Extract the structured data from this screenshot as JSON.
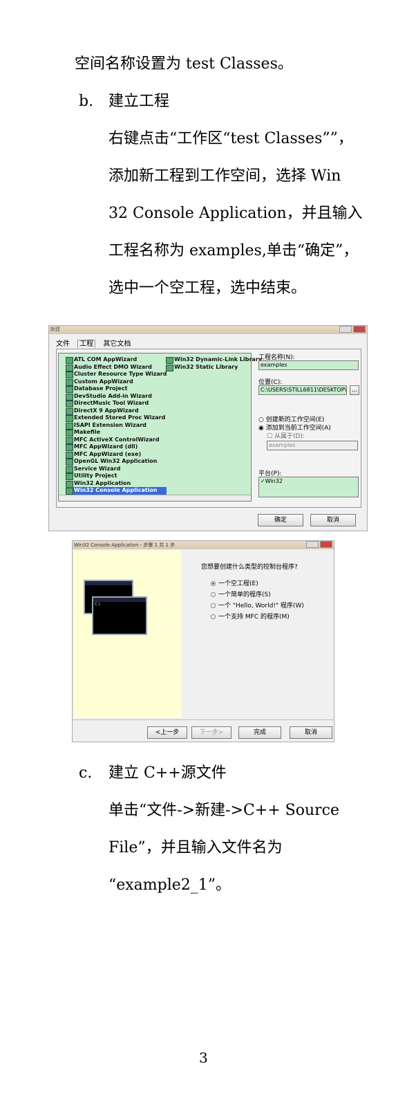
{
  "doc": {
    "line1": "空间名称设置为 test Classes。",
    "b_marker": "b.",
    "b_title": "建立工程",
    "b_p1": "右键点击“工作区“test Classes””，",
    "b_p2": "添加新工程到工作空间，选择 Win",
    "b_p3": "32 Console Application，并且输入",
    "b_p4": "工程名称为 examples,单击“确定”，",
    "b_p5": "选中一个空工程，选中结束。",
    "c_marker": "c.",
    "c_title": "建立 C++源文件",
    "c_p1": "单击“文件->新建->C++ Source",
    "c_p2": "File”，并且输入文件名为",
    "c_p3": "“example2_1”。",
    "page_number": "3"
  },
  "dialog_new": {
    "title": "新建",
    "tabs": [
      "文件",
      "工程",
      "其它文档"
    ],
    "project_types_col1": [
      "ATL COM AppWizard",
      "Audio Effect DMO Wizard",
      "Cluster Resource Type Wizard",
      "Custom AppWizard",
      "Database Project",
      "DevStudio Add-in Wizard",
      "DirectMusic Tool Wizard",
      "DirectX 9 AppWizard",
      "Extended Stored Proc Wizard",
      "ISAPI Extension Wizard",
      "Makefile",
      "MFC ActiveX ControlWizard",
      "MFC AppWizard (dll)",
      "MFC AppWizard (exe)",
      "OpenGL Win32 Application",
      "Service Wizard",
      "Utility Project",
      "Win32 Application",
      "Win32 Console Application"
    ],
    "project_types_col2": [
      "Win32 Dynamic-Link Library",
      "Win32 Static Library"
    ],
    "project_name_label": "工程名称(N):",
    "project_name_value": "examples",
    "location_label": "位置(C):",
    "location_value": "C:\\USERS\\STILL6811\\DESKTOP\\",
    "browse_label": "...",
    "radio_new": "创建新的工作空间(E)",
    "radio_add": "添加到当前工作空间(A)",
    "check_depend": "从属于(D):",
    "depend_value": "examples",
    "platform_label": "平台(P):",
    "platform_value": "Win32",
    "ok_label": "确定",
    "cancel_label": "取消"
  },
  "dialog_wizard": {
    "title": "Win32 Console Application - 步骤 1 共 1 步",
    "question": "您想要创建什么类型的控制台程序?",
    "options": [
      "一个空工程(E)",
      "一个简单的程序(S)",
      "一个 \"Hello, World!\" 程序(W)",
      "一个支持 MFC 的程序(M)"
    ],
    "console_prompt": "C:\\",
    "back_label": "<上一步",
    "next_label": "下一步>",
    "finish_label": "完成",
    "cancel_label": "取消"
  }
}
